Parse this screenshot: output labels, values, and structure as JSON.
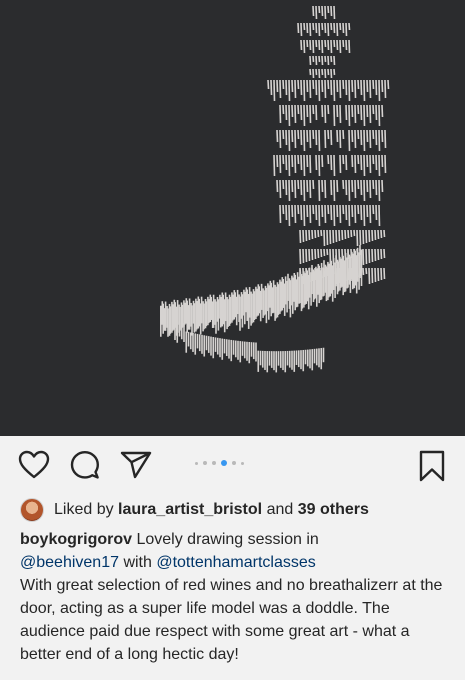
{
  "post": {
    "image_icon": "figure-drawing-artwork"
  },
  "actions": {
    "like_icon": "heart-icon",
    "comment_icon": "comment-icon",
    "share_icon": "paper-plane-icon",
    "save_icon": "bookmark-icon",
    "carousel": {
      "count": 6,
      "active_index": 3
    }
  },
  "likes": {
    "prefix": "Liked by",
    "user": "laura_artist_bristol",
    "connector": "and",
    "others": "39 others"
  },
  "caption": {
    "username": "boykogrigorov",
    "text1": "Lovely drawing session in",
    "mention1": "@beehiven17",
    "text2": "with",
    "mention2": "@tottenhamartclasses",
    "body": "With great selection of red wines and no breathalizerr at the door, acting as a super life model was a doddle. The audience paid due respect with some great art - what a better end of a long hectic day!"
  },
  "colors": {
    "background": "#f2f2f2",
    "image_bg": "#2b2c2e",
    "mention": "#003569",
    "active_dot": "#3897f0"
  }
}
